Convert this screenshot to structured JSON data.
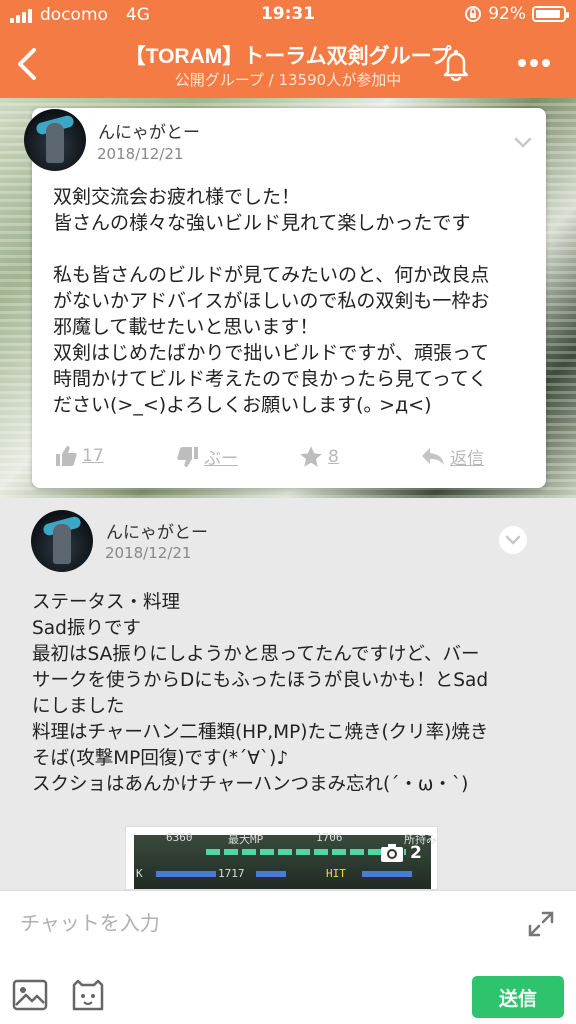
{
  "status_bar": {
    "carrier": "docomo",
    "network": "4G",
    "time": "19:31",
    "battery": "92%",
    "battery_level": 0.92
  },
  "header": {
    "title": "【TORAM】トーラム双剣グループ",
    "subtitle": "公開グループ / 13590人が参加中"
  },
  "posts": [
    {
      "author": "んにゃがとー",
      "date": "2018/12/21",
      "body": "双剣交流会お疲れ様でした！\n皆さんの様々な強いビルド見れて楽しかったです\n\n私も皆さんのビルドが見てみたいのと、何か改良点\nがないかアドバイスがほしいので私の双剣も一枠お\n邪魔して載せたいと思います！\n双剣はじめたばかりで拙いビルドですが、頑張って\n時間かけてビルド考えたので良かったら見てってく\nださい(>_<)よろしくお願いします(｡ >д<)",
      "likes": "17",
      "boo": "ぶー",
      "stars": "8",
      "reply": "返信"
    },
    {
      "author": "んにゃがとー",
      "date": "2018/12/21",
      "body": "ステータス・料理\nSad振りです\n最初はSA振りにしようかと思ってたんですけど、バー\nサークを使うからDにもふったほうが良いかも！とSad\nにしました\n料理はチャーハン二種類(HP,MP)たこ焼き(クリ率)焼き\nそば(攻撃MP回復)です(*´∀`)♪\nスクショはあんかけチャーハンつまみ忘れ(´・ω・`)"
    }
  ],
  "screenshot": {
    "hp": "6360",
    "max_mp_label": "最大MP",
    "max_mp": "1706",
    "held": "所持み",
    "value2": "1717",
    "hit": "HIT",
    "photo_count": "2",
    "k": "K"
  },
  "input": {
    "placeholder": "チャットを入力",
    "send_label": "送信"
  },
  "colors": {
    "accent": "#f47b43",
    "send": "#2ec46d"
  }
}
